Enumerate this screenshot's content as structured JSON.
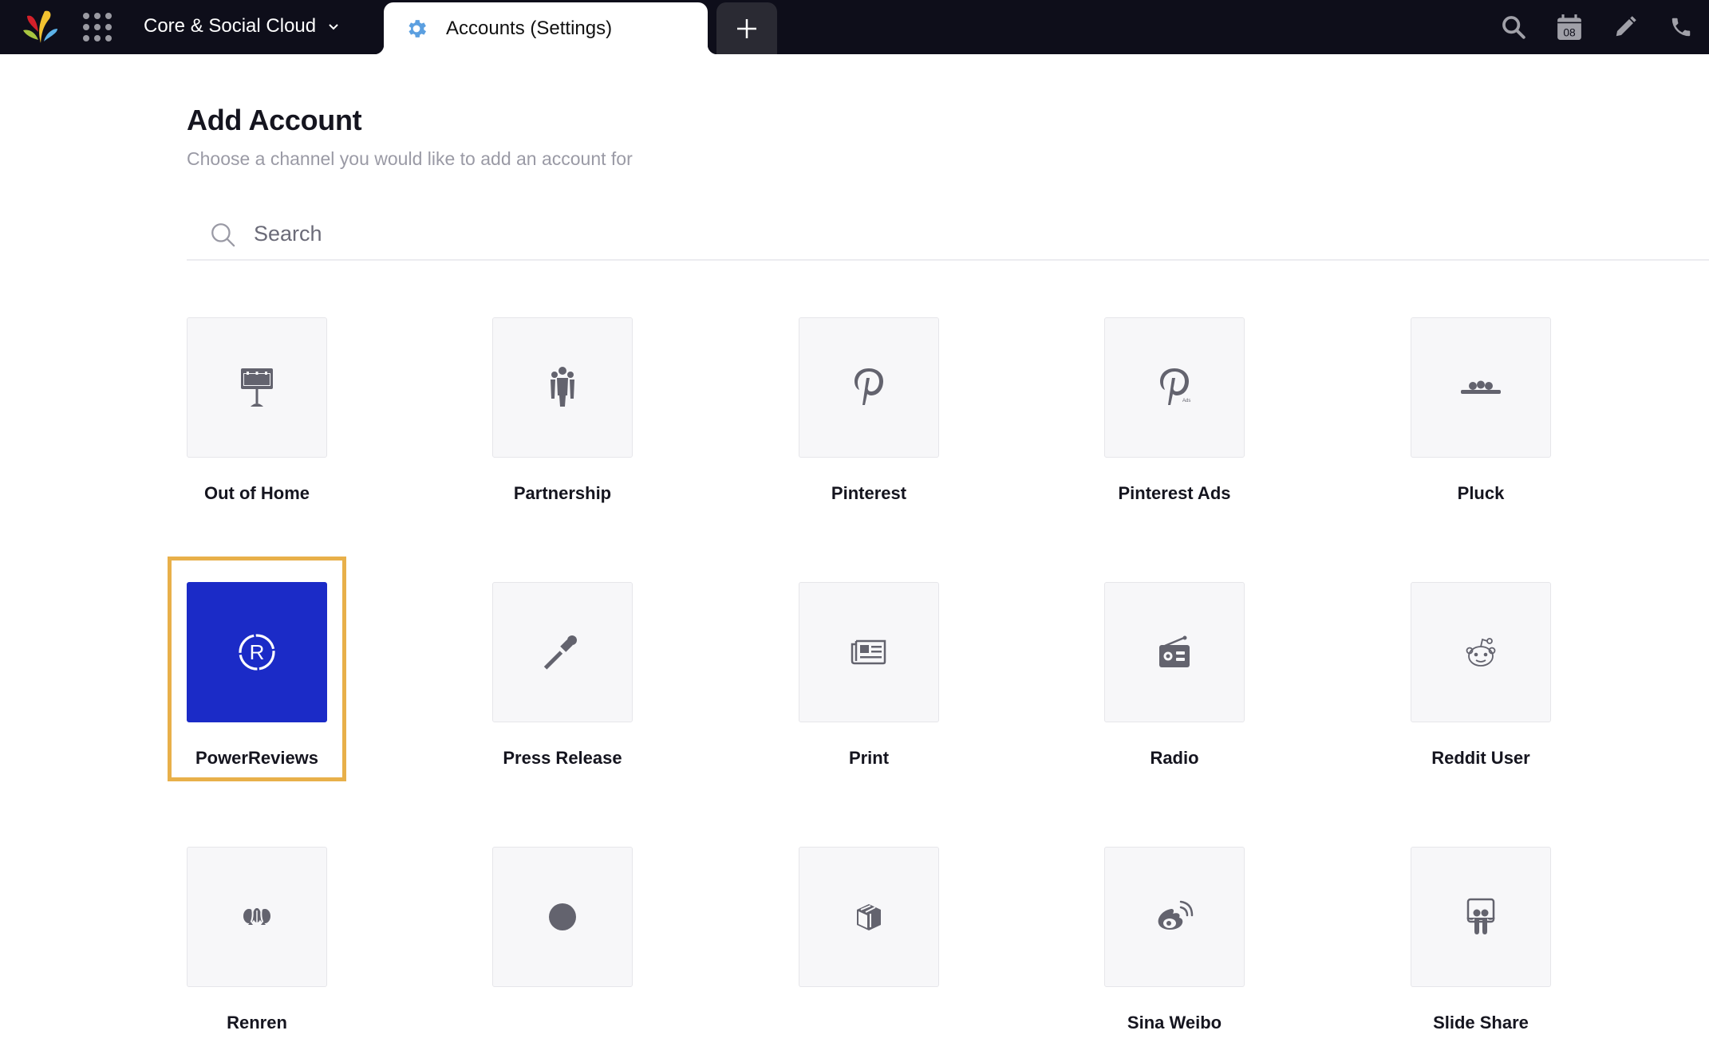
{
  "topbar": {
    "product_label": "Core & Social Cloud",
    "active_tab": {
      "label": "Accounts (Settings)",
      "icon": "gear-icon",
      "icon_color": "#5b9fe0"
    },
    "new_tab_icon": "plus-icon",
    "actions": [
      {
        "name": "search-icon"
      },
      {
        "name": "calendar-icon",
        "text": "08"
      },
      {
        "name": "pencil-icon"
      },
      {
        "name": "phone-icon"
      }
    ],
    "logo_colors": [
      "#d4202a",
      "#f2c230",
      "#a8c540",
      "#5cb2e8"
    ]
  },
  "page": {
    "title": "Add Account",
    "subtitle": "Choose a channel you would like to add an account for"
  },
  "search": {
    "placeholder": "Search",
    "value": ""
  },
  "channels": [
    {
      "label": "Out of Home",
      "icon": "billboard-icon"
    },
    {
      "label": "Partnership",
      "icon": "group-icon"
    },
    {
      "label": "Pinterest",
      "icon": "pinterest-icon"
    },
    {
      "label": "Pinterest Ads",
      "icon": "pinterest-ads-icon",
      "icon_caption": "Ads"
    },
    {
      "label": "Pluck",
      "icon": "pluck-icon"
    },
    {
      "label": "PowerReviews",
      "icon": "powerreviews-icon",
      "selected": true
    },
    {
      "label": "Press Release",
      "icon": "microphone-icon"
    },
    {
      "label": "Print",
      "icon": "newspaper-icon"
    },
    {
      "label": "Radio",
      "icon": "radio-icon"
    },
    {
      "label": "Reddit User",
      "icon": "reddit-icon"
    },
    {
      "label": "Renren",
      "icon": "renren-icon"
    },
    {
      "label": "",
      "icon": "circle-icon"
    },
    {
      "label": "",
      "icon": "box-icon"
    },
    {
      "label": "Sina Weibo",
      "icon": "weibo-icon"
    },
    {
      "label": "Slide Share",
      "icon": "slideshare-icon"
    }
  ],
  "colors": {
    "topbar_bg": "#0e0e1a",
    "selected_tile": "#1b2bc7",
    "highlight_border": "#e8b04a",
    "icon_gray": "#63636e"
  }
}
